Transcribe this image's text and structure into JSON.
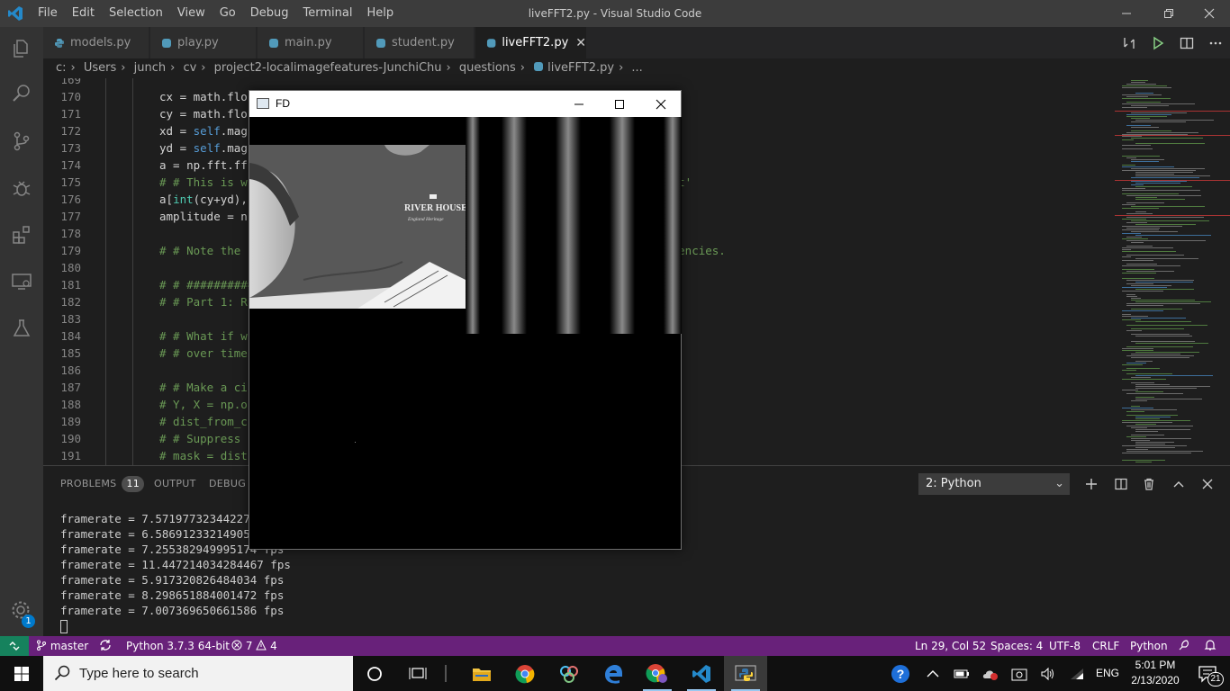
{
  "window": {
    "title": "liveFFT2.py - Visual Studio Code",
    "menu": [
      "File",
      "Edit",
      "Selection",
      "View",
      "Go",
      "Debug",
      "Terminal",
      "Help"
    ]
  },
  "tabs": [
    {
      "label": "models.py",
      "active": false
    },
    {
      "label": "play.py",
      "active": false
    },
    {
      "label": "main.py",
      "active": false
    },
    {
      "label": "student.py",
      "active": false
    },
    {
      "label": "liveFFT2.py",
      "active": true
    }
  ],
  "breadcrumb": [
    "c:",
    "Users",
    "junch",
    "cv",
    "project2-localimagefeatures-JunchiChu",
    "questions",
    "liveFFT2.py",
    "..."
  ],
  "editor": {
    "lines": [
      {
        "n": "169",
        "text": ""
      },
      {
        "n": "170",
        "text": "cx = math.flo"
      },
      {
        "n": "171",
        "text": "cy = math.flo"
      },
      {
        "n": "172",
        "text": "xd = self.mag"
      },
      {
        "n": "173",
        "text": "yd = self.mag"
      },
      {
        "n": "174",
        "text": "a = np.fft.ff"
      },
      {
        "n": "175",
        "text": "# # This is w",
        "tail": "pe 'lit'"
      },
      {
        "n": "176",
        "text": "a[int(cy+yd),"
      },
      {
        "n": "177",
        "text": "amplitude = n"
      },
      {
        "n": "178",
        "text": ""
      },
      {
        "n": "179",
        "text": "# # Note the",
        "tail": " frequencies."
      },
      {
        "n": "180",
        "text": ""
      },
      {
        "n": "181",
        "text": "# # ##########"
      },
      {
        "n": "182",
        "text": "# # Part 1: R"
      },
      {
        "n": "183",
        "text": ""
      },
      {
        "n": "184",
        "text": "# # What if w"
      },
      {
        "n": "185",
        "text": "# # over time"
      },
      {
        "n": "186",
        "text": ""
      },
      {
        "n": "187",
        "text": "# # Make a ci"
      },
      {
        "n": "188",
        "text": "# Y, X = np.o"
      },
      {
        "n": "189",
        "text": "# dist_from_c"
      },
      {
        "n": "190",
        "text": "# # Suppress"
      },
      {
        "n": "191",
        "text": "# mask = dist"
      }
    ]
  },
  "panel": {
    "tabs": {
      "problems": "PROBLEMS",
      "problems_count": "11",
      "output": "OUTPUT",
      "debug": "DEBUG C"
    },
    "terminal_select": "2: Python",
    "terminal_lines": [
      "framerate = 7.571977323442276",
      "framerate = 6.586912332149052",
      "framerate = 7.255382949995174 fps",
      "framerate = 11.447214034284467 fps",
      "framerate = 5.917320826484034 fps",
      "framerate = 8.298651884001472 fps",
      "framerate = 7.007369650661586 fps"
    ]
  },
  "fd_window": {
    "title": "FD",
    "shirt_text": "RIVER HOUSE",
    "shirt_subtext": "England Heritage"
  },
  "statusbar": {
    "branch": "master",
    "python": "Python 3.7.3 64-bit",
    "errors": "7",
    "warnings": "4",
    "position": "Ln 29, Col 52",
    "spaces": "Spaces: 4",
    "encoding": "UTF-8",
    "eol": "CRLF",
    "language": "Python",
    "settings_badge": "1"
  },
  "taskbar": {
    "search_placeholder": "Type here to search",
    "time": "5:01 PM",
    "date": "2/13/2020",
    "lang": "ENG",
    "notif_count": "21"
  },
  "colors": {
    "statusbar": "#68217a",
    "remote": "#16825d",
    "editor_bg": "#1e1e1e",
    "keyword": "#569cd6",
    "comment": "#6a9955",
    "string": "#ce9178"
  }
}
